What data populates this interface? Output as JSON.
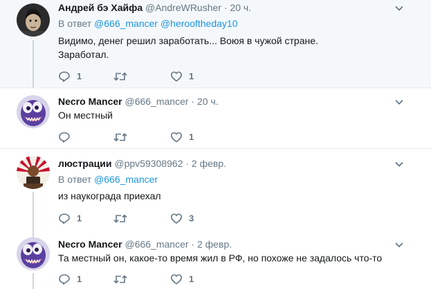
{
  "tweets": [
    {
      "name": "Андрей бэ Хайфа",
      "handle": "@AndreWRusher",
      "time": "20 ч.",
      "reply_prefix": "В ответ",
      "reply_mentions": [
        "@666_mancer",
        "@herooftheday10"
      ],
      "lines": [
        "Видимо, денег решил заработать... Воюя в чужой стране.",
        " Заработал."
      ],
      "replies": "1",
      "retweets": "",
      "likes": "1",
      "avatar": "man-face-avatar"
    },
    {
      "name": "Necro Mancer",
      "handle": "@666_mancer",
      "time": "20 ч.",
      "lines": [
        "Он местный"
      ],
      "replies": "",
      "retweets": "",
      "likes": "1",
      "avatar": "purple-monster-avatar"
    },
    {
      "name": "люстрации",
      "handle": "@ppv59308962",
      "time": "2 февр.",
      "reply_prefix": "В ответ",
      "reply_mentions": [
        "@666_mancer"
      ],
      "lines": [
        "из наукограда приехал"
      ],
      "replies": "1",
      "retweets": "",
      "likes": "3",
      "avatar": "sunburst-flag-avatar"
    },
    {
      "name": "Necro Mancer",
      "handle": "@666_mancer",
      "time": "2 февр.",
      "lines": [
        "Та местный он, какое-то время жил в РФ, но похоже не задалось что-то"
      ],
      "replies": "1",
      "retweets": "",
      "likes": "1",
      "avatar": "purple-monster-avatar"
    }
  ],
  "separator": "·",
  "icons": {
    "reply": "reply-icon",
    "retweet": "retweet-icon",
    "like": "heart-icon",
    "more": "chevron-down-icon"
  },
  "colors": {
    "highlight_bg": "#f5f8fa",
    "link": "#1b95e0",
    "muted": "#657786",
    "text": "#14171a",
    "divider": "#e6ecf0"
  }
}
